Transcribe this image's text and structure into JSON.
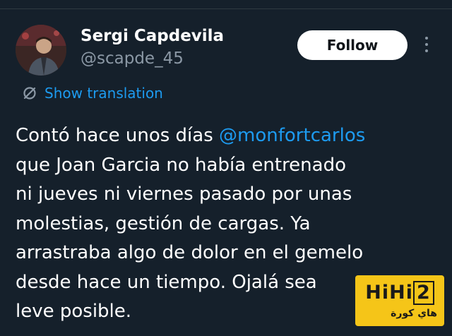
{
  "author": {
    "display_name": "Sergi Capdevila",
    "handle": "@scapde_45"
  },
  "actions": {
    "follow_label": "Follow",
    "more_icon": "more-vertical-icon"
  },
  "translation": {
    "label": "Show translation",
    "icon": "translate-icon"
  },
  "tweet": {
    "line1_prefix": "Contó hace unos días ",
    "mention": "@monfortcarlos",
    "line2": "que Joan Garcia no había entrenado",
    "line3": "ni jueves ni viernes pasado por unas",
    "line4": "molestias, gestión de cargas. Ya",
    "line5": "arrastraba algo de dolor en el gemelo",
    "line6": "desde hace un tiempo. Ojalá sea",
    "line7": "leve posible."
  },
  "watermark": {
    "logo_prefix": "HiHi",
    "logo_boxed": "2",
    "subtitle": "هاي كورة"
  },
  "colors": {
    "background": "#15202b",
    "link": "#1d9bf0",
    "secondary_text": "#8b98a5",
    "watermark": "#f5c518"
  }
}
